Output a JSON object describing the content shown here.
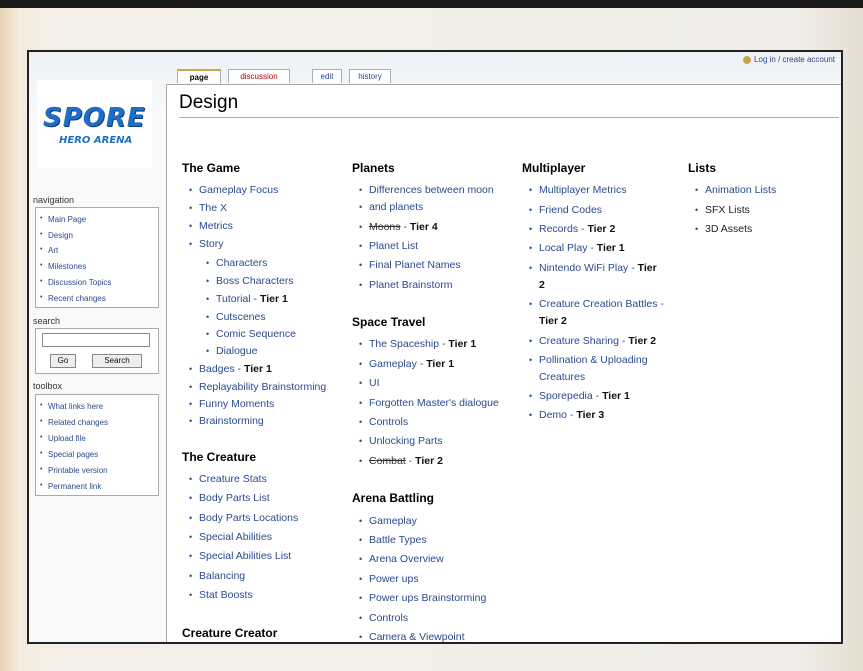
{
  "user_links": "Log in / create account",
  "tabs": {
    "page": "page",
    "discussion": "discussion",
    "edit": "edit",
    "history": "history"
  },
  "page_title": "Design",
  "logo": {
    "line1": "SPORE",
    "line2": "HERO ARENA"
  },
  "sidebar": {
    "navigation_title": "navigation",
    "navigation": [
      "Main Page",
      "Design",
      "Art",
      "Milestones",
      "Discussion Topics",
      "Recent changes"
    ],
    "search_title": "search",
    "go_label": "Go",
    "search_label": "Search",
    "toolbox_title": "toolbox",
    "toolbox": [
      "What links here",
      "Related changes",
      "Upload file",
      "Special pages",
      "Printable version",
      "Permanent link"
    ]
  },
  "sections": {
    "the_game": {
      "title": "The Game",
      "items": [
        "Gameplay Focus",
        "The X",
        "Metrics",
        "Story",
        "Characters",
        "Boss Characters",
        "Tutorial",
        "Cutscenes",
        "Comic Sequence",
        "Dialogue",
        "Badges",
        "Replayability Brainstorming",
        "Funny Moments",
        "Brainstorming"
      ],
      "tier_tutorial": "Tier 1",
      "tier_badges": "Tier 1"
    },
    "the_creature": {
      "title": "The Creature",
      "items": [
        "Creature Stats",
        "Body Parts List",
        "Body Parts Locations",
        "Special Abilities",
        "Special Abilities List",
        "Balancing",
        "Stat Boosts"
      ]
    },
    "creature_creator": {
      "title": "Creature Creator"
    },
    "planets": {
      "title": "Planets",
      "items": [
        "Differences between moon",
        "and planets",
        "Moons",
        "Planet List",
        "Final Planet Names",
        "Planet Brainstorm"
      ],
      "tier_moons": "Tier 4"
    },
    "space_travel": {
      "title": "Space Travel",
      "items": [
        "The Spaceship",
        "Gameplay",
        "UI",
        "Forgotten Master's dialogue",
        "Controls",
        "Unlocking Parts",
        "Combat"
      ],
      "tier_spaceship": "Tier 1",
      "tier_gameplay": "Tier 1",
      "tier_combat": "Tier 2"
    },
    "arena_battling": {
      "title": "Arena Battling",
      "items": [
        "Gameplay",
        "Battle Types",
        "Arena Overview",
        "Power ups",
        "Power ups Brainstorming",
        "Controls",
        "Camera & Viewpoint"
      ]
    },
    "multiplayer": {
      "title": "Multiplayer",
      "items": [
        "Multiplayer Metrics",
        "Friend Codes",
        "Records",
        "Local Play",
        "Nintendo WiFi Play",
        "Creature Creation Battles",
        "Creature Sharing",
        "Pollination & Uploading",
        "Creatures",
        "Sporepedia",
        "Demo"
      ],
      "tier_records": "Tier 2",
      "tier_local": "Tier 1",
      "tier_wifi_a": "Tier",
      "tier_wifi_b": "2",
      "tier_ccb": "Tier 2",
      "tier_sharing": "Tier 2",
      "tier_sporepedia": "Tier 1",
      "tier_demo": "Tier 3"
    },
    "lists": {
      "title": "Lists",
      "items": [
        "Animation Lists",
        "SFX Lists",
        "3D Assets"
      ]
    }
  }
}
